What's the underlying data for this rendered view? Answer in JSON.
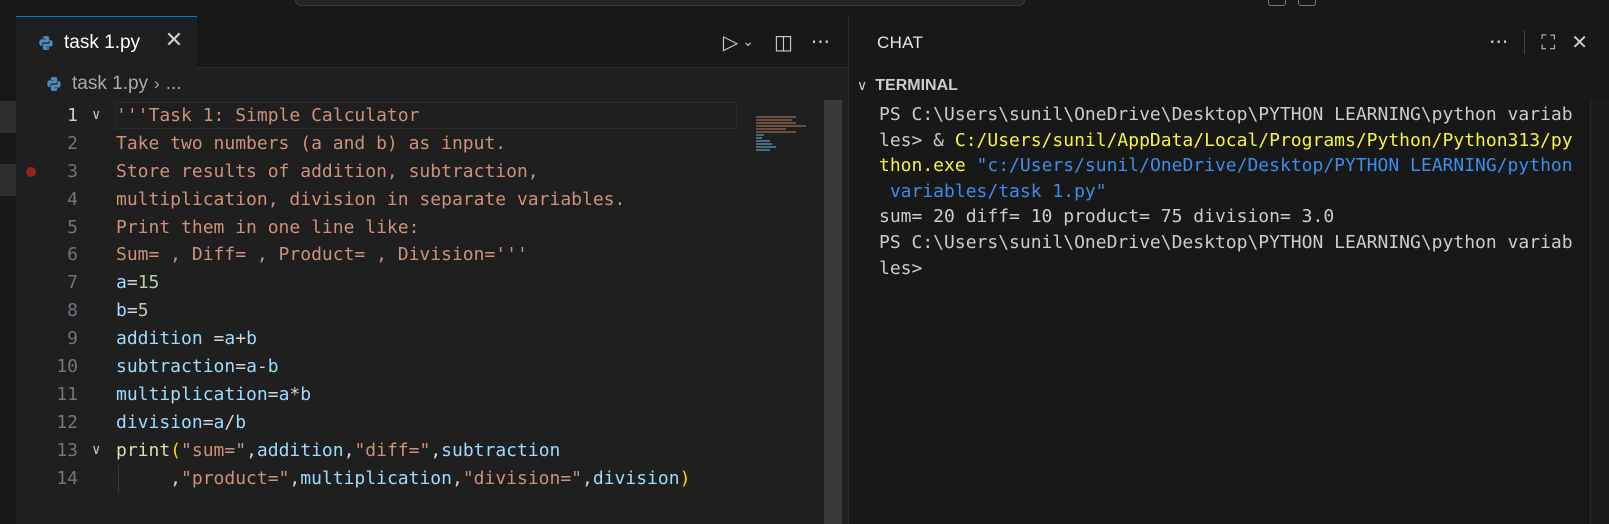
{
  "tab": {
    "label": "task 1.py"
  },
  "breadcrumb": {
    "file": "task 1.py",
    "rest": "..."
  },
  "editor_actions": {
    "run": "▷",
    "run_dropdown": "⌄",
    "split": "◫",
    "more": "···"
  },
  "code_lines": [
    {
      "num": "1",
      "parts": [
        {
          "t": "'''Task 1: Simple Calculator",
          "c": "str"
        }
      ]
    },
    {
      "num": "2",
      "parts": [
        {
          "t": "Take two numbers (a and b) as input.",
          "c": "str"
        }
      ]
    },
    {
      "num": "3",
      "parts": [
        {
          "t": "Store results of addition, subtraction,",
          "c": "str"
        }
      ]
    },
    {
      "num": "4",
      "parts": [
        {
          "t": "multiplication, division in separate variables.",
          "c": "str"
        }
      ]
    },
    {
      "num": "5",
      "parts": [
        {
          "t": "Print them in one line like:",
          "c": "str"
        }
      ]
    },
    {
      "num": "6",
      "parts": [
        {
          "t": "Sum= , Diff= , Product= , Division='''",
          "c": "str"
        }
      ]
    },
    {
      "num": "7",
      "parts": [
        {
          "t": "a",
          "c": "var"
        },
        {
          "t": "=",
          "c": "op"
        },
        {
          "t": "15",
          "c": "num"
        }
      ]
    },
    {
      "num": "8",
      "parts": [
        {
          "t": "b",
          "c": "var"
        },
        {
          "t": "=",
          "c": "op"
        },
        {
          "t": "5",
          "c": "num"
        }
      ]
    },
    {
      "num": "9",
      "parts": [
        {
          "t": "addition",
          "c": "var"
        },
        {
          "t": " =",
          "c": "op"
        },
        {
          "t": "a",
          "c": "var"
        },
        {
          "t": "+",
          "c": "op"
        },
        {
          "t": "b",
          "c": "var"
        }
      ]
    },
    {
      "num": "10",
      "parts": [
        {
          "t": "subtraction",
          "c": "var"
        },
        {
          "t": "=",
          "c": "op"
        },
        {
          "t": "a",
          "c": "var"
        },
        {
          "t": "-",
          "c": "op"
        },
        {
          "t": "b",
          "c": "var"
        }
      ]
    },
    {
      "num": "11",
      "parts": [
        {
          "t": "multiplication",
          "c": "var"
        },
        {
          "t": "=",
          "c": "op"
        },
        {
          "t": "a",
          "c": "var"
        },
        {
          "t": "*",
          "c": "op"
        },
        {
          "t": "b",
          "c": "var"
        }
      ]
    },
    {
      "num": "12",
      "parts": [
        {
          "t": "division",
          "c": "var"
        },
        {
          "t": "=",
          "c": "op"
        },
        {
          "t": "a",
          "c": "var"
        },
        {
          "t": "/",
          "c": "op"
        },
        {
          "t": "b",
          "c": "var"
        }
      ]
    },
    {
      "num": "13",
      "parts": [
        {
          "t": "print",
          "c": "fn"
        },
        {
          "t": "(",
          "c": "par"
        },
        {
          "t": "\"sum=\"",
          "c": "str"
        },
        {
          "t": ",",
          "c": "op"
        },
        {
          "t": "addition",
          "c": "var"
        },
        {
          "t": ",",
          "c": "op"
        },
        {
          "t": "\"diff=\"",
          "c": "str"
        },
        {
          "t": ",",
          "c": "op"
        },
        {
          "t": "subtraction",
          "c": "var"
        }
      ]
    },
    {
      "num": "14",
      "parts": [
        {
          "t": "     ,",
          "c": "op"
        },
        {
          "t": "\"product=\"",
          "c": "str"
        },
        {
          "t": ",",
          "c": "op"
        },
        {
          "t": "multiplication",
          "c": "var"
        },
        {
          "t": ",",
          "c": "op"
        },
        {
          "t": "\"division=\"",
          "c": "str"
        },
        {
          "t": ",",
          "c": "op"
        },
        {
          "t": "division",
          "c": "var"
        },
        {
          "t": ")",
          "c": "par"
        }
      ]
    }
  ],
  "panel": {
    "title": "CHAT",
    "more": "···",
    "maximize": "⛶",
    "close": "✕",
    "section": "TERMINAL"
  },
  "terminal_lines": [
    [
      {
        "t": "PS C:\\Users\\sunil\\OneDrive\\Desktop\\PYTHON LEARNING\\python variab",
        "c": ""
      }
    ],
    [
      {
        "t": "les> & ",
        "c": ""
      },
      {
        "t": "C:/Users/sunil/AppData/Local/Programs/Python/Python313/py",
        "c": "t-yellow"
      }
    ],
    [
      {
        "t": "thon.exe ",
        "c": "t-yellow"
      },
      {
        "t": "\"c:/Users/sunil/OneDrive/Desktop/PYTHON LEARNING/python",
        "c": "t-blue"
      }
    ],
    [
      {
        "t": " variables/task 1.py\"",
        "c": "t-blue"
      }
    ],
    [
      {
        "t": "sum= 20 diff= 10 product= 75 division= 3.0",
        "c": ""
      }
    ],
    [
      {
        "t": "PS C:\\Users\\sunil\\OneDrive\\Desktop\\PYTHON LEARNING\\python variab",
        "c": ""
      }
    ],
    [
      {
        "t": "les>",
        "c": ""
      }
    ]
  ]
}
